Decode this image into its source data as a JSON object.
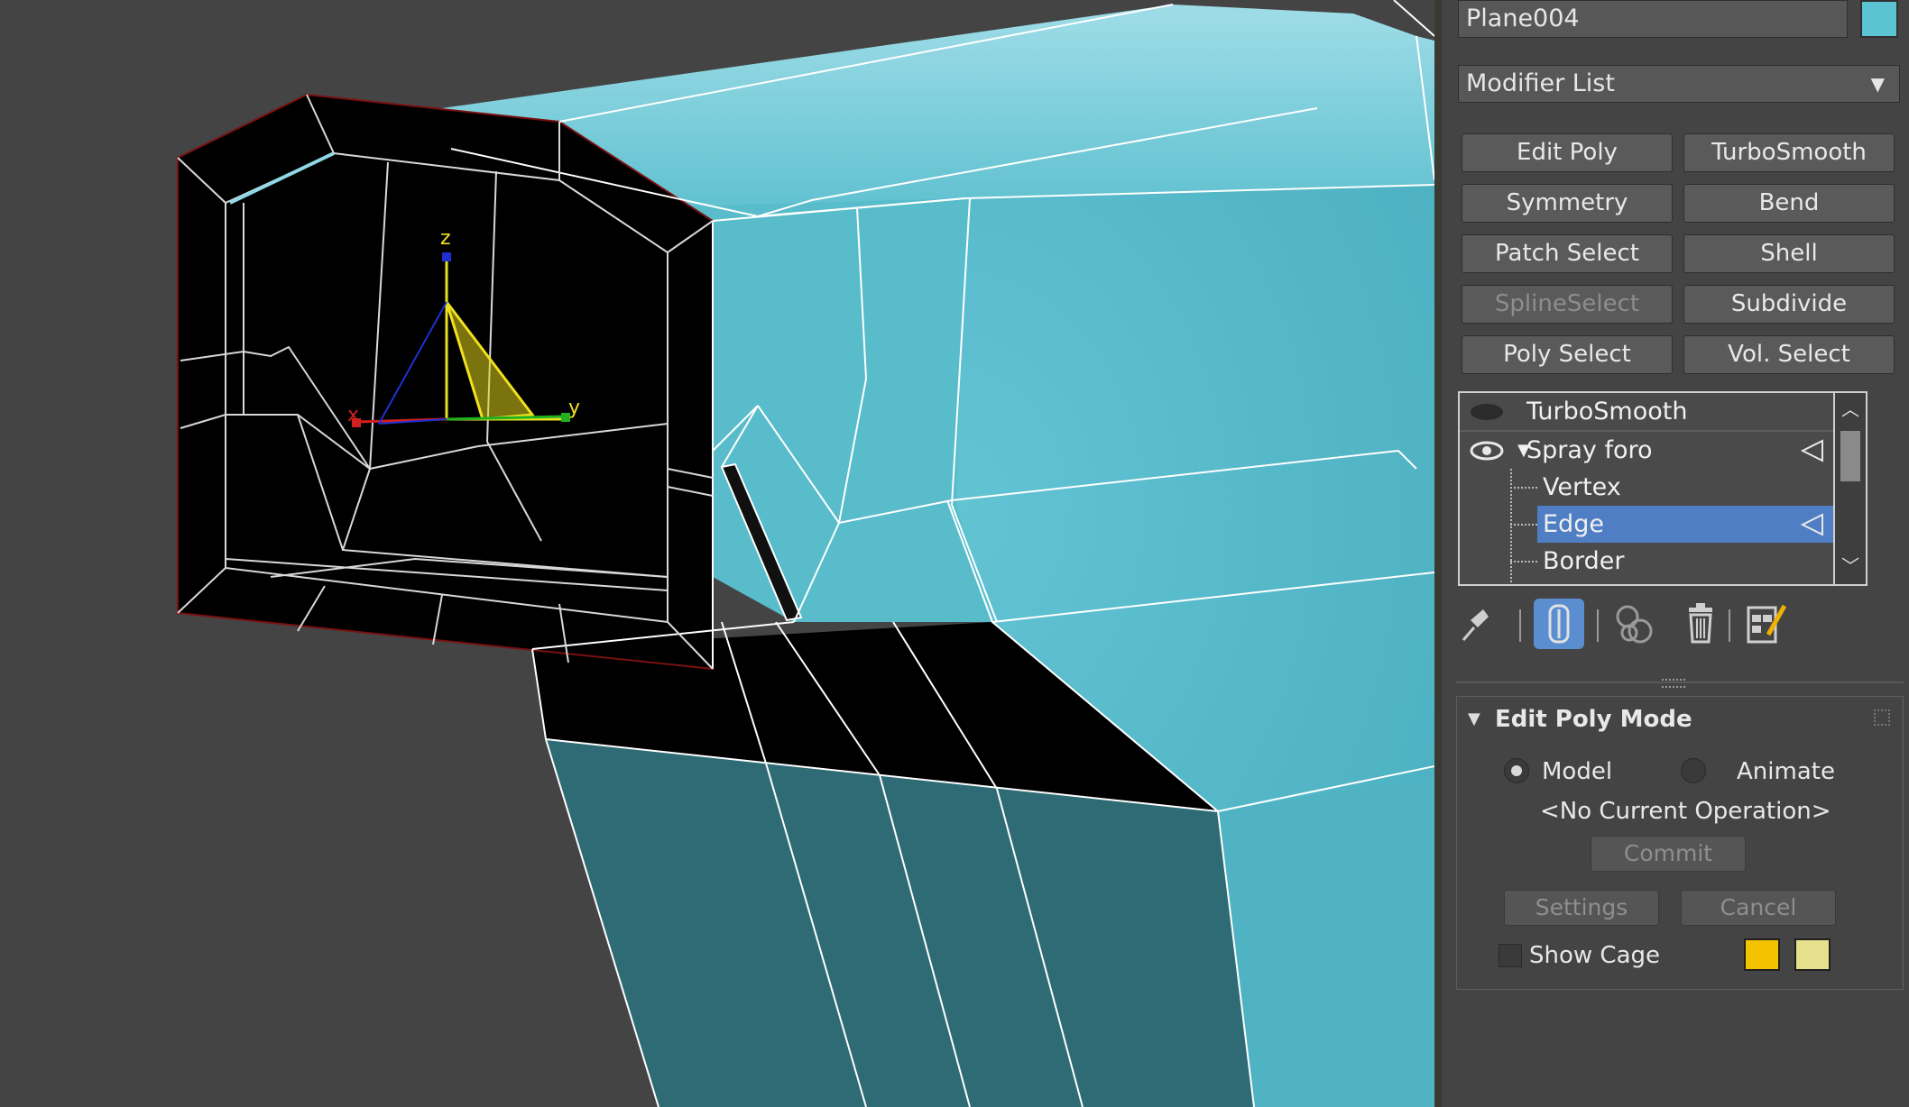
{
  "object": {
    "name": "Plane004",
    "color": "#5bc3d2"
  },
  "modifier_list": {
    "label": "Modifier List"
  },
  "modifier_buttons": [
    {
      "label": "Edit Poly",
      "enabled": true
    },
    {
      "label": "TurboSmooth",
      "enabled": true
    },
    {
      "label": "Symmetry",
      "enabled": true
    },
    {
      "label": "Bend",
      "enabled": true
    },
    {
      "label": "Patch Select",
      "enabled": true
    },
    {
      "label": "Shell",
      "enabled": true
    },
    {
      "label": "SplineSelect",
      "enabled": false
    },
    {
      "label": "Subdivide",
      "enabled": true
    },
    {
      "label": "Poly Select",
      "enabled": true
    },
    {
      "label": "Vol. Select",
      "enabled": true
    }
  ],
  "stack": {
    "items": [
      {
        "label": "TurboSmooth"
      },
      {
        "label": "Spray foro"
      },
      {
        "label": "Vertex"
      },
      {
        "label": "Edge",
        "selected": true
      },
      {
        "label": "Border"
      }
    ]
  },
  "stack_tools": [
    "pin-stack-icon",
    "show-end-result-icon",
    "make-unique-icon",
    "remove-modifier-icon",
    "configure-modifier-sets-icon"
  ],
  "rollout": {
    "title": "Edit Poly Mode",
    "model_label": "Model",
    "animate_label": "Animate",
    "mode_selected": "Model",
    "operation": "<No Current Operation>",
    "commit_label": "Commit",
    "settings_label": "Settings",
    "cancel_label": "Cancel",
    "show_cage_label": "Show Cage",
    "show_cage_checked": false,
    "cage_color_1": "#f5c200",
    "cage_color_2": "#e4e08c"
  },
  "viewport": {
    "gizmo_axes": [
      "x",
      "y",
      "z"
    ],
    "mesh_color": "#55b8c8"
  }
}
